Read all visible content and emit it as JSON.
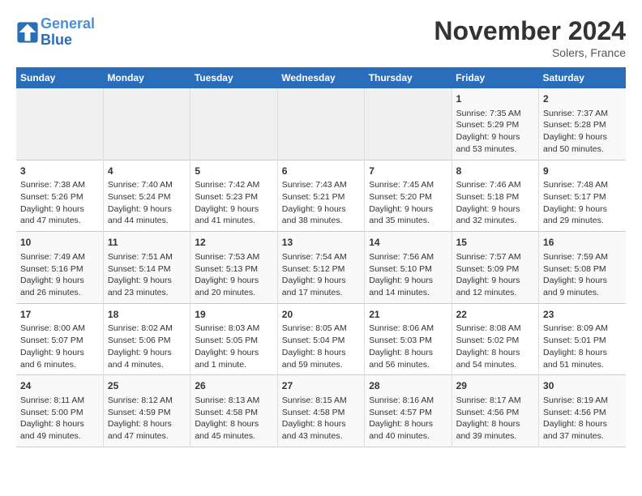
{
  "logo": {
    "line1": "General",
    "line2": "Blue"
  },
  "title": "November 2024",
  "location": "Solers, France",
  "weekdays": [
    "Sunday",
    "Monday",
    "Tuesday",
    "Wednesday",
    "Thursday",
    "Friday",
    "Saturday"
  ],
  "weeks": [
    [
      {
        "day": "",
        "info": ""
      },
      {
        "day": "",
        "info": ""
      },
      {
        "day": "",
        "info": ""
      },
      {
        "day": "",
        "info": ""
      },
      {
        "day": "",
        "info": ""
      },
      {
        "day": "1",
        "info": "Sunrise: 7:35 AM\nSunset: 5:29 PM\nDaylight: 9 hours\nand 53 minutes."
      },
      {
        "day": "2",
        "info": "Sunrise: 7:37 AM\nSunset: 5:28 PM\nDaylight: 9 hours\nand 50 minutes."
      }
    ],
    [
      {
        "day": "3",
        "info": "Sunrise: 7:38 AM\nSunset: 5:26 PM\nDaylight: 9 hours\nand 47 minutes."
      },
      {
        "day": "4",
        "info": "Sunrise: 7:40 AM\nSunset: 5:24 PM\nDaylight: 9 hours\nand 44 minutes."
      },
      {
        "day": "5",
        "info": "Sunrise: 7:42 AM\nSunset: 5:23 PM\nDaylight: 9 hours\nand 41 minutes."
      },
      {
        "day": "6",
        "info": "Sunrise: 7:43 AM\nSunset: 5:21 PM\nDaylight: 9 hours\nand 38 minutes."
      },
      {
        "day": "7",
        "info": "Sunrise: 7:45 AM\nSunset: 5:20 PM\nDaylight: 9 hours\nand 35 minutes."
      },
      {
        "day": "8",
        "info": "Sunrise: 7:46 AM\nSunset: 5:18 PM\nDaylight: 9 hours\nand 32 minutes."
      },
      {
        "day": "9",
        "info": "Sunrise: 7:48 AM\nSunset: 5:17 PM\nDaylight: 9 hours\nand 29 minutes."
      }
    ],
    [
      {
        "day": "10",
        "info": "Sunrise: 7:49 AM\nSunset: 5:16 PM\nDaylight: 9 hours\nand 26 minutes."
      },
      {
        "day": "11",
        "info": "Sunrise: 7:51 AM\nSunset: 5:14 PM\nDaylight: 9 hours\nand 23 minutes."
      },
      {
        "day": "12",
        "info": "Sunrise: 7:53 AM\nSunset: 5:13 PM\nDaylight: 9 hours\nand 20 minutes."
      },
      {
        "day": "13",
        "info": "Sunrise: 7:54 AM\nSunset: 5:12 PM\nDaylight: 9 hours\nand 17 minutes."
      },
      {
        "day": "14",
        "info": "Sunrise: 7:56 AM\nSunset: 5:10 PM\nDaylight: 9 hours\nand 14 minutes."
      },
      {
        "day": "15",
        "info": "Sunrise: 7:57 AM\nSunset: 5:09 PM\nDaylight: 9 hours\nand 12 minutes."
      },
      {
        "day": "16",
        "info": "Sunrise: 7:59 AM\nSunset: 5:08 PM\nDaylight: 9 hours\nand 9 minutes."
      }
    ],
    [
      {
        "day": "17",
        "info": "Sunrise: 8:00 AM\nSunset: 5:07 PM\nDaylight: 9 hours\nand 6 minutes."
      },
      {
        "day": "18",
        "info": "Sunrise: 8:02 AM\nSunset: 5:06 PM\nDaylight: 9 hours\nand 4 minutes."
      },
      {
        "day": "19",
        "info": "Sunrise: 8:03 AM\nSunset: 5:05 PM\nDaylight: 9 hours\nand 1 minute."
      },
      {
        "day": "20",
        "info": "Sunrise: 8:05 AM\nSunset: 5:04 PM\nDaylight: 8 hours\nand 59 minutes."
      },
      {
        "day": "21",
        "info": "Sunrise: 8:06 AM\nSunset: 5:03 PM\nDaylight: 8 hours\nand 56 minutes."
      },
      {
        "day": "22",
        "info": "Sunrise: 8:08 AM\nSunset: 5:02 PM\nDaylight: 8 hours\nand 54 minutes."
      },
      {
        "day": "23",
        "info": "Sunrise: 8:09 AM\nSunset: 5:01 PM\nDaylight: 8 hours\nand 51 minutes."
      }
    ],
    [
      {
        "day": "24",
        "info": "Sunrise: 8:11 AM\nSunset: 5:00 PM\nDaylight: 8 hours\nand 49 minutes."
      },
      {
        "day": "25",
        "info": "Sunrise: 8:12 AM\nSunset: 4:59 PM\nDaylight: 8 hours\nand 47 minutes."
      },
      {
        "day": "26",
        "info": "Sunrise: 8:13 AM\nSunset: 4:58 PM\nDaylight: 8 hours\nand 45 minutes."
      },
      {
        "day": "27",
        "info": "Sunrise: 8:15 AM\nSunset: 4:58 PM\nDaylight: 8 hours\nand 43 minutes."
      },
      {
        "day": "28",
        "info": "Sunrise: 8:16 AM\nSunset: 4:57 PM\nDaylight: 8 hours\nand 40 minutes."
      },
      {
        "day": "29",
        "info": "Sunrise: 8:17 AM\nSunset: 4:56 PM\nDaylight: 8 hours\nand 39 minutes."
      },
      {
        "day": "30",
        "info": "Sunrise: 8:19 AM\nSunset: 4:56 PM\nDaylight: 8 hours\nand 37 minutes."
      }
    ]
  ]
}
